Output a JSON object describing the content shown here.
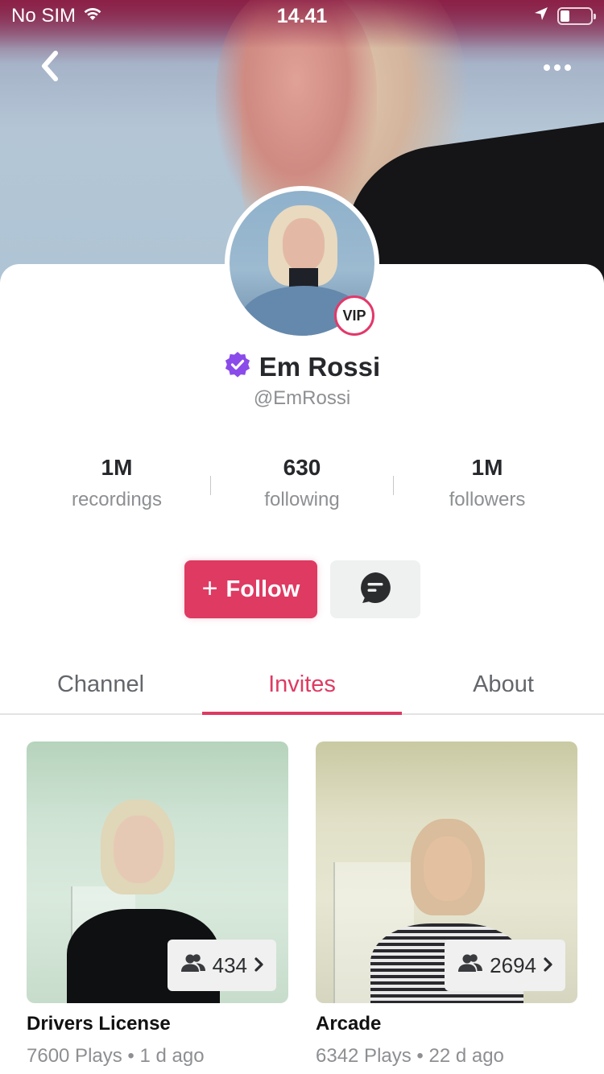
{
  "status_bar": {
    "carrier": "No SIM",
    "time": "14.41",
    "battery_level": 0.3
  },
  "header": {
    "back_icon": "chevron-left-icon",
    "more_icon": "more-horizontal-icon"
  },
  "profile": {
    "name": "Em Rossi",
    "handle": "@EmRossi",
    "verified": true,
    "badge": "VIP"
  },
  "stats": [
    {
      "value": "1M",
      "label": "recordings"
    },
    {
      "value": "630",
      "label": "following"
    },
    {
      "value": "1M",
      "label": "followers"
    }
  ],
  "actions": {
    "follow_plus": "+",
    "follow_label": "Follow",
    "message_icon": "chat-bubble-icon"
  },
  "tabs": [
    {
      "label": "Channel",
      "active": false
    },
    {
      "label": "Invites",
      "active": true
    },
    {
      "label": "About",
      "active": false
    }
  ],
  "colors": {
    "accent": "#de3a62",
    "verified": "#8a4bea",
    "text_primary": "#26282c",
    "text_secondary": "#8d8f92"
  },
  "invites": [
    {
      "title": "Drivers License",
      "participants": "434",
      "meta": "7600 Plays • 1 d ago"
    },
    {
      "title": "Arcade",
      "participants": "2694",
      "meta": "6342 Plays • 22 d ago"
    }
  ]
}
